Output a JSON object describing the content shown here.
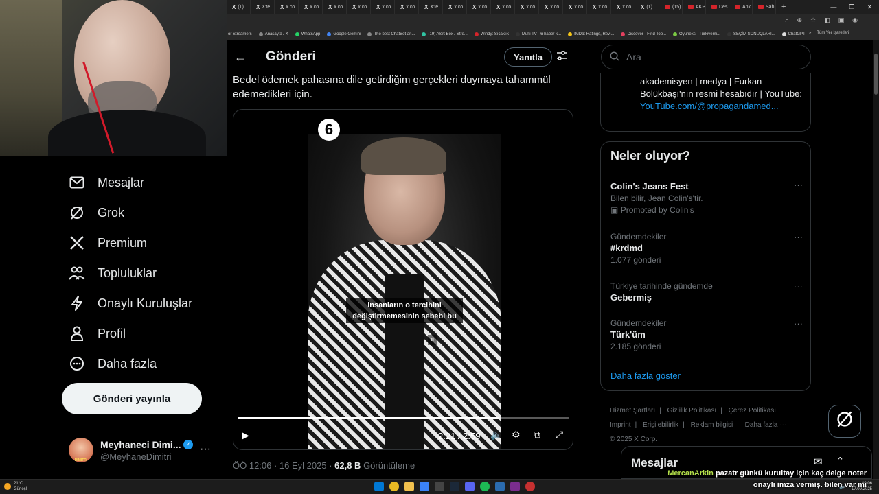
{
  "browser": {
    "tabs": [
      "(1)",
      "X'te",
      "x.co",
      "x.co",
      "x.co",
      "x.co",
      "x.co",
      "x.co",
      "X'te",
      "x.co",
      "x.co",
      "x.co",
      "x.co",
      "x.co",
      "x.co",
      "x.co",
      "x.co",
      "(1)",
      "(15)",
      "AKP",
      "Des",
      "Ank",
      "Sab"
    ],
    "new_tab": "+",
    "bookmarks": [
      "or Streamers",
      "Anasayfa / X",
      "WhatsApp",
      "Google Gemini",
      "The best ChatBot an...",
      "(19) Alert Box / Stre...",
      "Windy: Sıcaklık",
      "Multi TV - 6 haber k...",
      "IMDb: Ratings, Revi...",
      "Discover - Find Top...",
      "Oyuneks - Türkiyemi...",
      "SEÇİM SONUÇLARI...",
      "ChatGPT"
    ],
    "bookmarks_overflow": "»",
    "all_bookmarks": "Tüm Yer İşaretleri"
  },
  "nav": {
    "items": [
      {
        "label": "Mesajlar",
        "icon": "mail-icon"
      },
      {
        "label": "Grok",
        "icon": "grok-icon"
      },
      {
        "label": "Premium",
        "icon": "x-logo-icon"
      },
      {
        "label": "Topluluklar",
        "icon": "communities-icon"
      },
      {
        "label": "Onaylı Kuruluşlar",
        "icon": "lightning-icon"
      },
      {
        "label": "Profil",
        "icon": "person-icon"
      },
      {
        "label": "Daha fazla",
        "icon": "more-circle-icon"
      }
    ],
    "post_button": "Gönderi yayınla",
    "profile": {
      "name": "Meyhaneci Dimi...",
      "handle": "@MeyhaneDimitri",
      "avatar_text": "DIMITRI"
    }
  },
  "post": {
    "header_title": "Gönderi",
    "reply_button": "Yanıtla",
    "text": "Bedel ödemek pahasına dile getirdiğim gerçekleri duymaya tahammül edemedikleri için.",
    "video": {
      "logo": "6",
      "caption_line1": "insanların o tercihini",
      "caption_line2": "değiştirmemesinin sebebi bu",
      "pause_indicator": "⏸",
      "time": "2:21 / 2:59",
      "progress_fraction": 0.788
    },
    "meta_time": "ÖÖ 12:06 · 16 Eyl 2025 · ",
    "meta_views": "62,8 B",
    "meta_views_label": " Görüntüleme"
  },
  "search": {
    "placeholder": "Ara"
  },
  "bio": {
    "text": "akademisyen | medya | Furkan Bölükbaşı'nın resmi hesabıdır | YouTube:",
    "link": "YouTube.com/@propagandamed..."
  },
  "trends": {
    "title": "Neler oluyor?",
    "items": [
      {
        "context": "",
        "name": "Colin's Jeans Fest",
        "sub": "Bilen bilir, Jean Colin's'tir.",
        "promo": "Promoted by Colin's"
      },
      {
        "context": "Gündemdekiler",
        "name": "#krdmd",
        "sub": "1.077 gönderi"
      },
      {
        "context": "Türkiye tarihinde gündemde",
        "name": "Gebermiş",
        "sub": ""
      },
      {
        "context": "Gündemdekiler",
        "name": "Türk'üm",
        "sub": "2.185 gönderi"
      }
    ],
    "more": "Daha fazla göster"
  },
  "footer": {
    "links": [
      "Hizmet Şartları",
      "Gizlilik Politikası",
      "Çerez Politikası",
      "Imprint",
      "Erişilebilirlik",
      "Reklam bilgisi",
      "Daha fazla ···"
    ],
    "copyright": "© 2025 X Corp."
  },
  "messages_drawer": {
    "title": "Mesajlar"
  },
  "chat_overlay": {
    "user": "MercanArkin",
    "message": "pazatr günkü kurultay için kaç delge noter onaylı imza vermiş. bilen var mı"
  },
  "taskbar": {
    "weather_temp": "21°C",
    "weather_desc": "Güneşli",
    "time": "09:06",
    "date": "17.09.2025"
  },
  "colors": {
    "accent": "#1d9bf0",
    "background": "#000000",
    "border": "#2f3336"
  }
}
